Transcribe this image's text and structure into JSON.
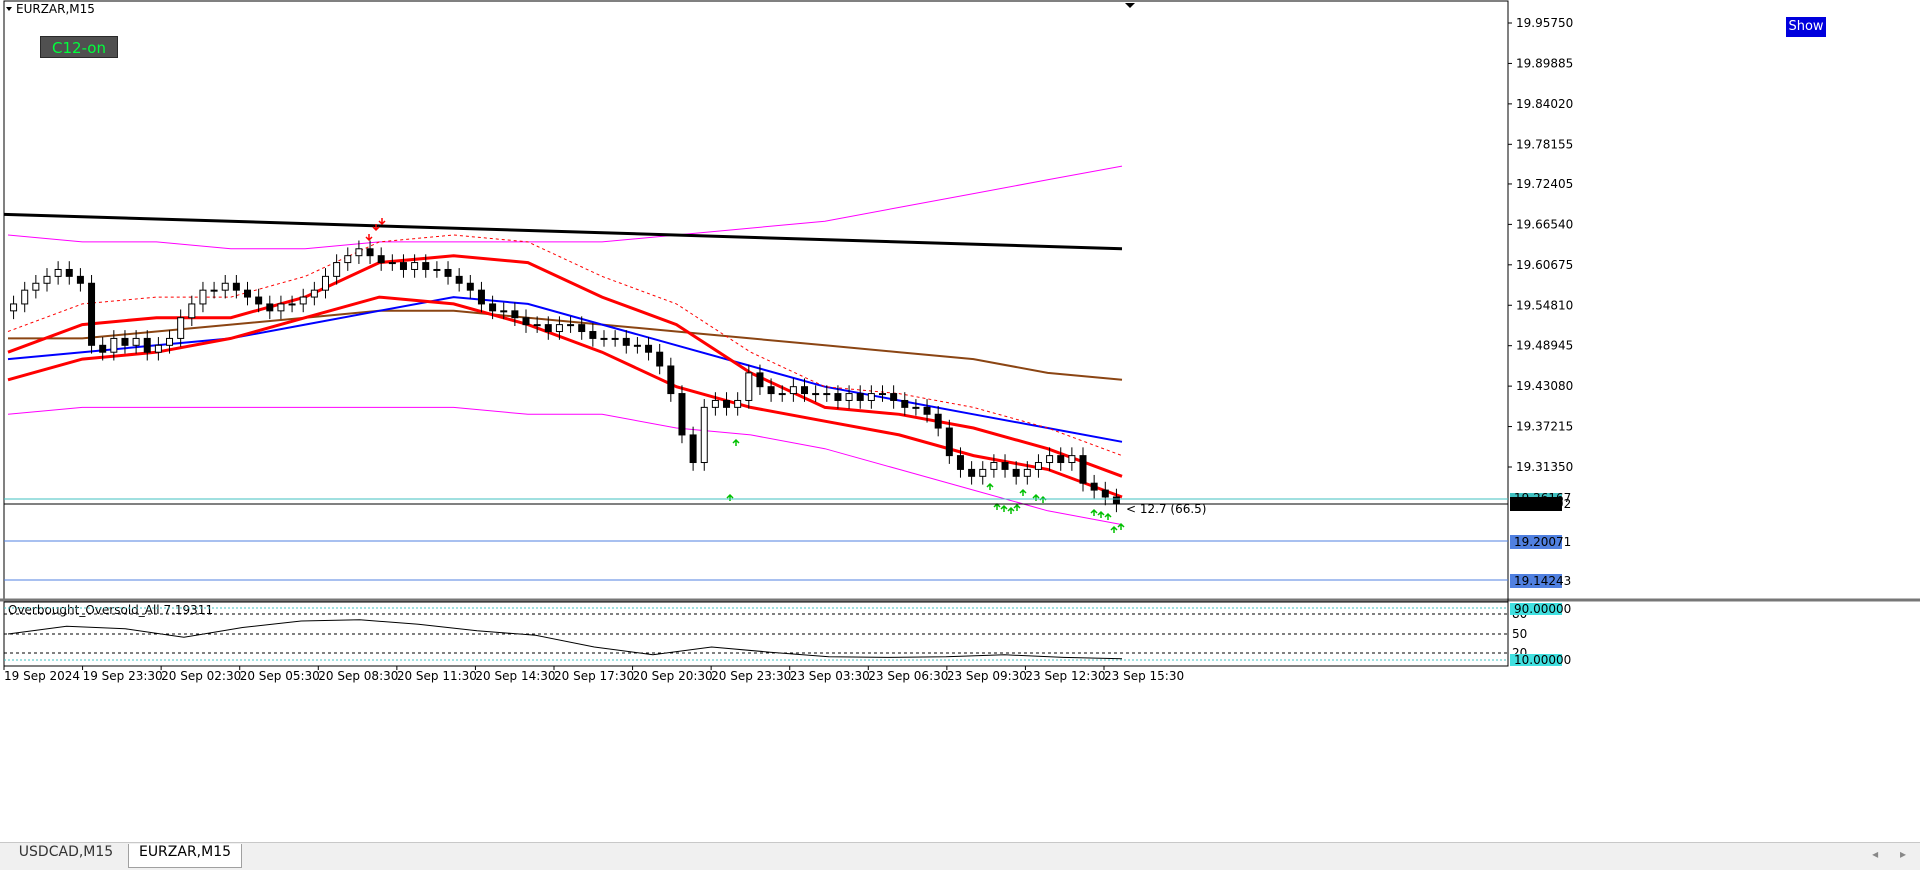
{
  "symbol_title": "EURZAR,M15",
  "buttons": {
    "c12": "C12-on",
    "show": "Show"
  },
  "price_axis": [
    "19.95750",
    "19.89885",
    "19.84020",
    "19.78155",
    "19.72405",
    "19.66540",
    "19.60675",
    "19.54810",
    "19.48945",
    "19.43080",
    "19.37215",
    "19.31350"
  ],
  "price_marks": {
    "current": "19.25492",
    "level1": "19.20071",
    "level2": "19.14243",
    "hidden": "19.26167"
  },
  "annotation": "< 12.7 (66.5)",
  "indicator": {
    "title": "Overbought_Oversold_All 7.19311",
    "levels": [
      "80",
      "50",
      "20"
    ],
    "marks": {
      "upper": "90.00000",
      "lower": "10.00000"
    }
  },
  "time_axis": [
    "19 Sep 2024",
    "19 Sep 23:30",
    "20 Sep 02:30",
    "20 Sep 05:30",
    "20 Sep 08:30",
    "20 Sep 11:30",
    "20 Sep 14:30",
    "20 Sep 17:30",
    "20 Sep 20:30",
    "20 Sep 23:30",
    "23 Sep 03:30",
    "23 Sep 06:30",
    "23 Sep 09:30",
    "23 Sep 12:30",
    "23 Sep 15:30"
  ],
  "tabs": [
    "USDCAD,M15",
    "EURZAR,M15"
  ],
  "colors": {
    "bull": "#ffffff",
    "bear": "#000000",
    "fast_ma": "#ff0000",
    "mid_ma": "#0000ff",
    "slow_ma": "#8b4513",
    "trend": "#000000",
    "band": "#ff00ff"
  },
  "chart_data": {
    "type": "candlestick",
    "symbol": "EURZAR",
    "timeframe": "M15",
    "ylim": [
      19.12,
      19.99
    ],
    "x_start": "19 Sep 2024",
    "x_end": "23 Sep 15:30",
    "close_path": [
      19.55,
      19.57,
      19.58,
      19.59,
      19.6,
      19.59,
      19.58,
      19.49,
      19.48,
      19.5,
      19.49,
      19.5,
      19.48,
      19.49,
      19.5,
      19.53,
      19.55,
      19.57,
      19.57,
      19.58,
      19.57,
      19.56,
      19.55,
      19.54,
      19.55,
      19.55,
      19.56,
      19.57,
      19.59,
      19.61,
      19.62,
      19.63,
      19.62,
      19.61,
      19.61,
      19.6,
      19.61,
      19.6,
      19.6,
      19.59,
      19.58,
      19.57,
      19.55,
      19.54,
      19.54,
      19.53,
      19.52,
      19.52,
      19.51,
      19.52,
      19.52,
      19.51,
      19.5,
      19.5,
      19.5,
      19.49,
      19.49,
      19.48,
      19.46,
      19.42,
      19.36,
      19.32,
      19.4,
      19.41,
      19.4,
      19.41,
      19.45,
      19.43,
      19.42,
      19.42,
      19.43,
      19.42,
      19.42,
      19.42,
      19.41,
      19.42,
      19.41,
      19.42,
      19.42,
      19.41,
      19.4,
      19.4,
      19.39,
      19.37,
      19.33,
      19.31,
      19.3,
      19.31,
      19.32,
      19.31,
      19.3,
      19.31,
      19.32,
      19.33,
      19.32,
      19.33,
      19.29,
      19.28,
      19.27,
      19.26
    ],
    "trend_line": [
      [
        0,
        19.68
      ],
      [
        1,
        19.63
      ]
    ],
    "fast_ma_upper": [
      19.48,
      19.52,
      19.53,
      19.53,
      19.56,
      19.61,
      19.62,
      19.61,
      19.56,
      19.52,
      19.45,
      19.4,
      19.39,
      19.37,
      19.34,
      19.3
    ],
    "fast_ma_lower": [
      19.44,
      19.47,
      19.48,
      19.5,
      19.53,
      19.56,
      19.55,
      19.52,
      19.48,
      19.43,
      19.4,
      19.38,
      19.36,
      19.33,
      19.31,
      19.27
    ],
    "mid_ma": [
      19.47,
      19.48,
      19.49,
      19.5,
      19.52,
      19.54,
      19.56,
      19.55,
      19.52,
      19.49,
      19.46,
      19.43,
      19.41,
      19.39,
      19.37,
      19.35
    ],
    "slow_ma": [
      19.5,
      19.5,
      19.51,
      19.52,
      19.53,
      19.54,
      19.54,
      19.53,
      19.52,
      19.51,
      19.5,
      19.49,
      19.48,
      19.47,
      19.45,
      19.44
    ],
    "band_upper": [
      19.65,
      19.64,
      19.64,
      19.63,
      19.63,
      19.64,
      19.64,
      19.64,
      19.64,
      19.65,
      19.66,
      19.67,
      19.69,
      19.71,
      19.73,
      19.75
    ],
    "band_lower": [
      19.39,
      19.4,
      19.4,
      19.4,
      19.4,
      19.4,
      19.4,
      19.39,
      19.39,
      19.37,
      19.36,
      19.34,
      19.31,
      19.28,
      19.25,
      19.23
    ],
    "osc": [
      50,
      62,
      58,
      45,
      60,
      70,
      72,
      65,
      55,
      48,
      30,
      18,
      30,
      22,
      15,
      14,
      15,
      18,
      14,
      12
    ]
  }
}
